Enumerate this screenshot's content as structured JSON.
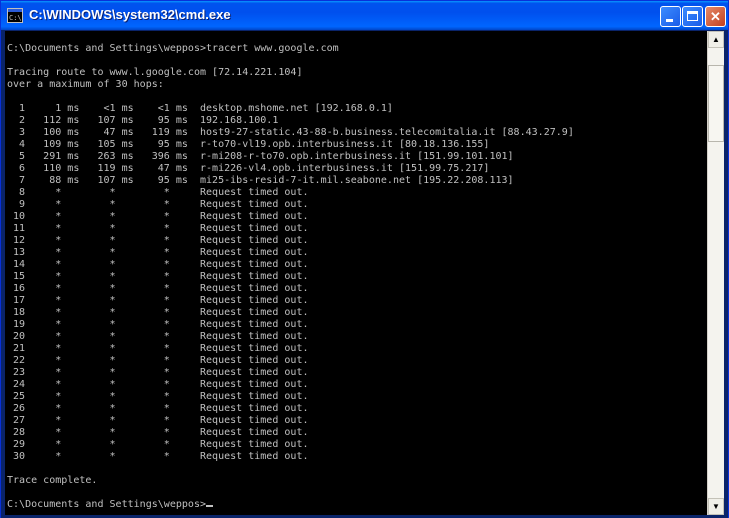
{
  "window": {
    "title": "C:\\WINDOWS\\system32\\cmd.exe",
    "icon": "cmd-icon",
    "icon_text": "C:\\",
    "controls": [
      "minimize-icon",
      "maximize-icon",
      "close-icon"
    ],
    "close_glyph": "✕"
  },
  "scrollbar": {
    "up_glyph": "▲",
    "down_glyph": "▼"
  },
  "console": {
    "text_color": "#c0c0c0",
    "background": "#000000",
    "lines": [
      "C:\\Documents and Settings\\weppos>tracert www.google.com",
      "",
      "Tracing route to www.l.google.com [72.14.221.104]",
      "over a maximum of 30 hops:",
      "",
      "  1     1 ms    <1 ms    <1 ms  desktop.mshome.net [192.168.0.1]",
      "  2   112 ms   107 ms    95 ms  192.168.100.1",
      "  3   100 ms    47 ms   119 ms  host9-27-static.43-88-b.business.telecomitalia.it [88.43.27.9]",
      "  4   109 ms   105 ms    95 ms  r-to70-vl19.opb.interbusiness.it [80.18.136.155]",
      "  5   291 ms   263 ms   396 ms  r-mi208-r-to70.opb.interbusiness.it [151.99.101.101]",
      "  6   110 ms   119 ms    47 ms  r-mi226-vl4.opb.interbusiness.it [151.99.75.217]",
      "  7    88 ms   107 ms    95 ms  mi25-ibs-resid-7-it.mil.seabone.net [195.22.208.113]",
      "  8     *        *        *     Request timed out.",
      "  9     *        *        *     Request timed out.",
      " 10     *        *        *     Request timed out.",
      " 11     *        *        *     Request timed out.",
      " 12     *        *        *     Request timed out.",
      " 13     *        *        *     Request timed out.",
      " 14     *        *        *     Request timed out.",
      " 15     *        *        *     Request timed out.",
      " 16     *        *        *     Request timed out.",
      " 17     *        *        *     Request timed out.",
      " 18     *        *        *     Request timed out.",
      " 19     *        *        *     Request timed out.",
      " 20     *        *        *     Request timed out.",
      " 21     *        *        *     Request timed out.",
      " 22     *        *        *     Request timed out.",
      " 23     *        *        *     Request timed out.",
      " 24     *        *        *     Request timed out.",
      " 25     *        *        *     Request timed out.",
      " 26     *        *        *     Request timed out.",
      " 27     *        *        *     Request timed out.",
      " 28     *        *        *     Request timed out.",
      " 29     *        *        *     Request timed out.",
      " 30     *        *        *     Request timed out.",
      "",
      "Trace complete.",
      ""
    ],
    "prompt": "C:\\Documents and Settings\\weppos>"
  }
}
